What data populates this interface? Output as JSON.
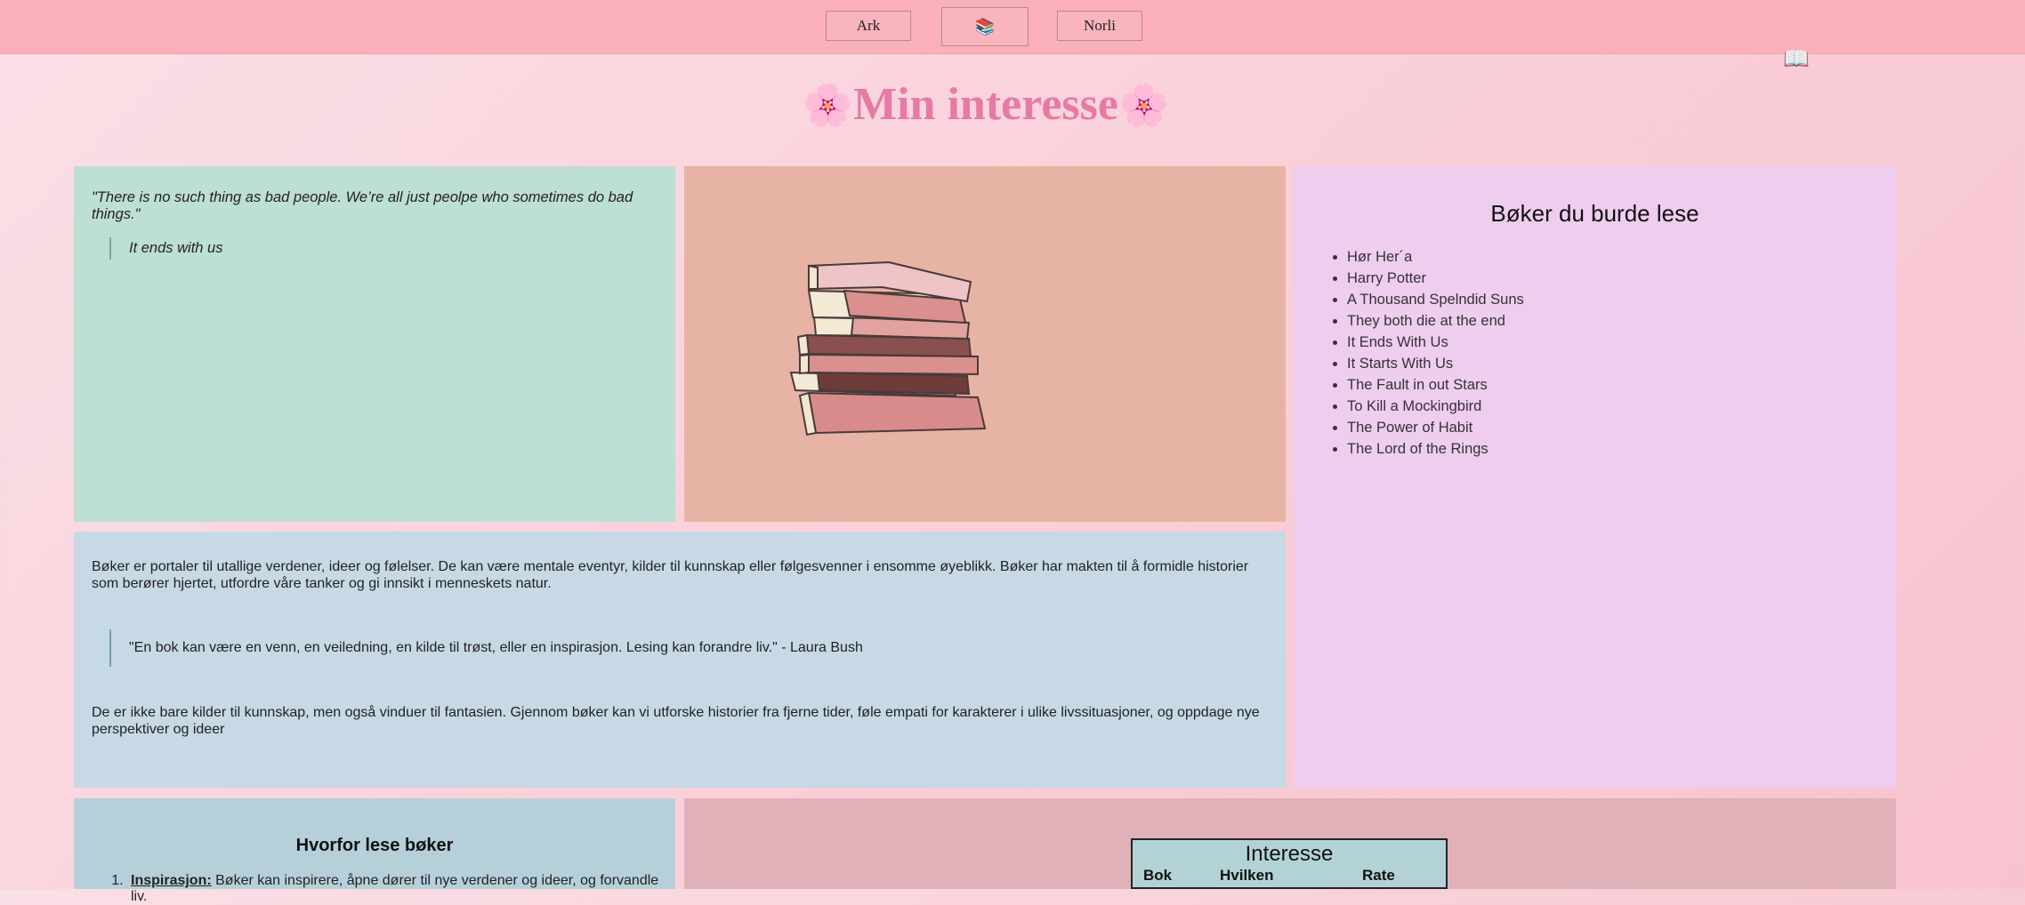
{
  "nav": {
    "buttons": [
      {
        "label": "Ark"
      },
      {
        "label": "📚"
      },
      {
        "label": "Norli"
      }
    ],
    "floating_icon": "📖"
  },
  "header": {
    "flower": "🌸",
    "title": "Min interesse"
  },
  "quote_panel": {
    "quote": "\"There is no such thing as bad people. We’re all just peolpe who sometimes do bad things.\"",
    "source": "It ends with us"
  },
  "books_panel": {
    "title": "Bøker du burde lese",
    "items": [
      "Hør Her´a",
      "Harry Potter",
      "A Thousand Spelndid Suns",
      "They both die at the end",
      "It Ends With Us",
      "It Starts With Us",
      "The Fault in out Stars",
      "To Kill a Mockingbird",
      "The Power of Habit",
      "The Lord of the Rings"
    ]
  },
  "about_panel": {
    "paragraph1": "Bøker er portaler til utallige verdener, ideer og følelser. De kan være mentale eventyr, kilder til kunnskap eller følgesvenner i ensomme øyeblikk. Bøker har makten til å formidle historier som berører hjertet, utfordre våre tanker og gi innsikt i menneskets natur.",
    "quote": "\"En bok kan være en venn, en veiledning, en kilde til trøst, eller en inspirasjon. Lesing kan forandre liv.\" - Laura Bush",
    "paragraph2": "De er ikke bare kilder til kunnskap, men også vinduer til fantasien. Gjennom bøker kan vi utforske historier fra fjerne tider, føle empati for karakterer i ulike livssituasjoner, og oppdage nye perspektiver og ideer"
  },
  "why_panel": {
    "title": "Hvorfor lese bøker",
    "items": [
      {
        "term": "Inspirasjon:",
        "text": " Bøker kan inspirere, åpne dører til nye verdener og ideer, og forvandle liv."
      }
    ]
  },
  "table_panel": {
    "caption": "Interesse",
    "headers": [
      "Bok",
      "Hvilken",
      "Rate"
    ]
  },
  "colors": {
    "topbar": "#f9b0ba",
    "title": "#e77aa5",
    "quote_panel": "#bedfd3",
    "image_panel": "#e6b3a5",
    "books_panel": "#efcdef",
    "about_panel": "#c6d9e5",
    "why_panel": "#b5d0d9",
    "table_panel": "#e0b1b9"
  }
}
